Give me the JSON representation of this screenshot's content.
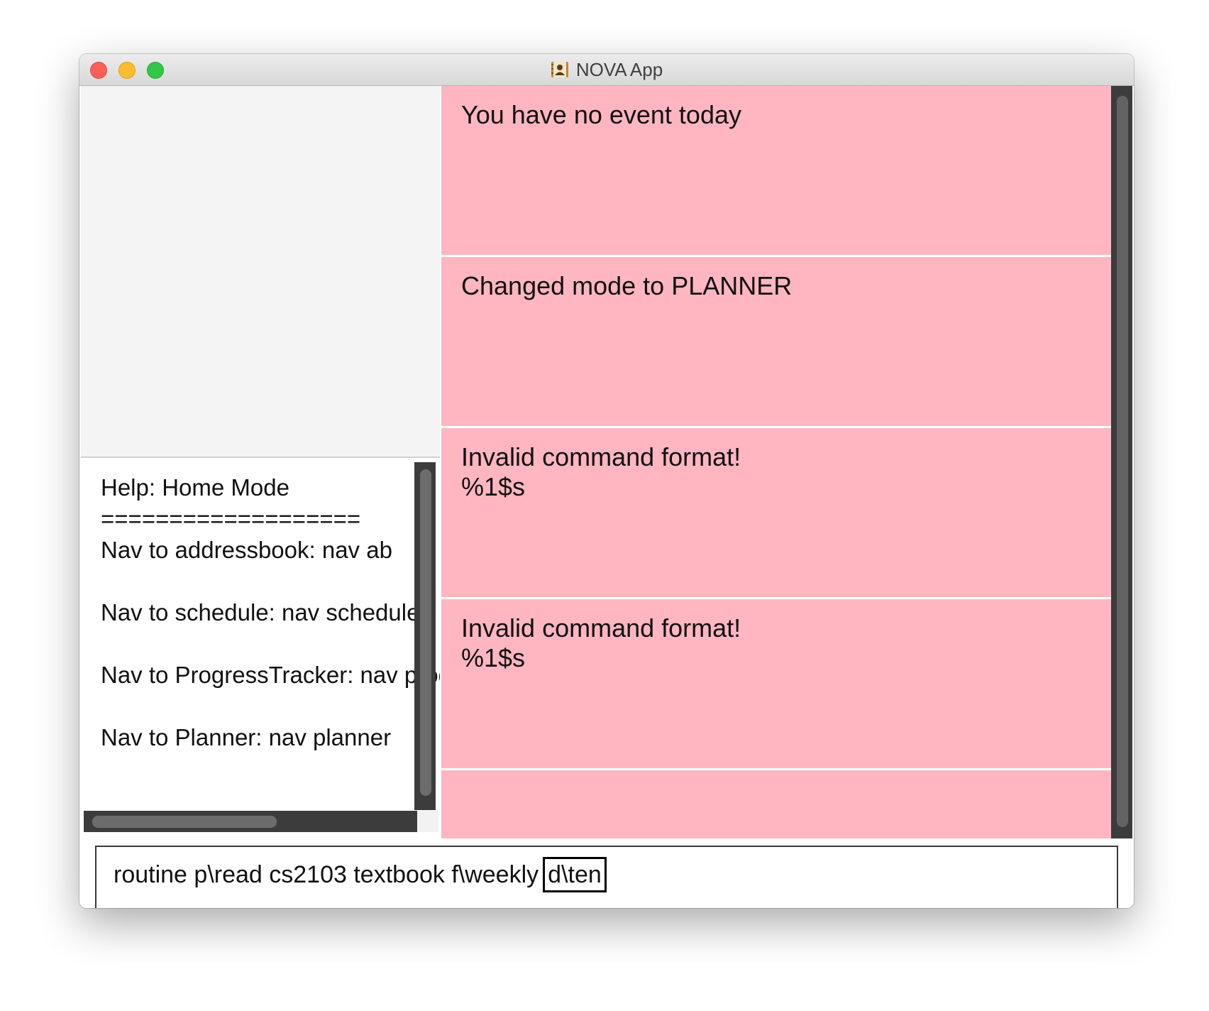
{
  "window": {
    "title": "NOVA App",
    "icon": "address-book-icon"
  },
  "help": {
    "lines": [
      "Help: Home Mode",
      "===================",
      "Nav to addressbook: nav ab",
      "",
      "Nav to schedule: nav schedule",
      "",
      "Nav to ProgressTracker: nav progresstracker",
      "",
      "Nav to Planner: nav planner"
    ]
  },
  "results": [
    {
      "text": "You have no event today"
    },
    {
      "text": "Changed mode to PLANNER"
    },
    {
      "text": "Invalid command format!\n%1$s"
    },
    {
      "text": "Invalid command format!\n%1$s"
    },
    {
      "text": ""
    }
  ],
  "command": {
    "text": "routine p\\read cs2103 textbook f\\weekly",
    "highlighted": "d\\ten"
  },
  "colors": {
    "result_bg": "#ffb6c1",
    "scrollbar_track": "#3c3c3c",
    "scrollbar_thumb": "#6c6c6c"
  }
}
